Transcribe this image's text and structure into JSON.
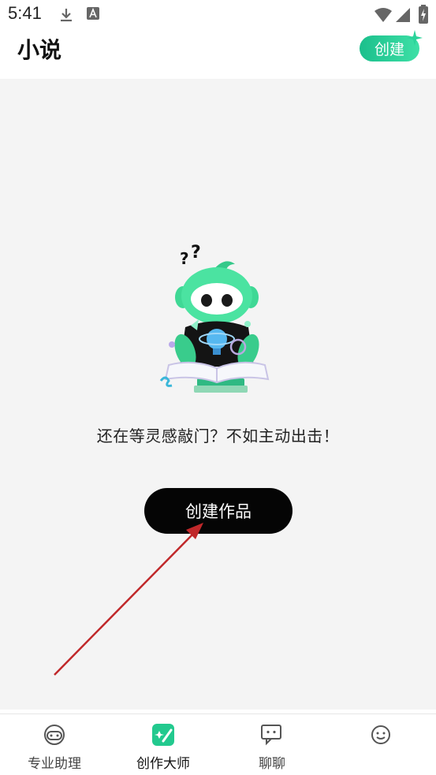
{
  "status_bar": {
    "time": "5:41"
  },
  "header": {
    "title": "小说",
    "create_label": "创建"
  },
  "main": {
    "empty_message": "还在等灵感敲门？不如主动出击！",
    "primary_button": "创建作品"
  },
  "bottom_nav": {
    "items": [
      {
        "label": "专业助理",
        "icon": "robot-icon"
      },
      {
        "label": "创作大师",
        "icon": "pen-sparkle-icon",
        "active": true
      },
      {
        "label": "聊聊",
        "icon": "chat-bubble-icon"
      },
      {
        "label": "",
        "icon": "smiley-icon"
      }
    ]
  },
  "colors": {
    "accent": "#1bbf8c",
    "button_dark": "#050505",
    "annotation_arrow": "#c0282a"
  }
}
